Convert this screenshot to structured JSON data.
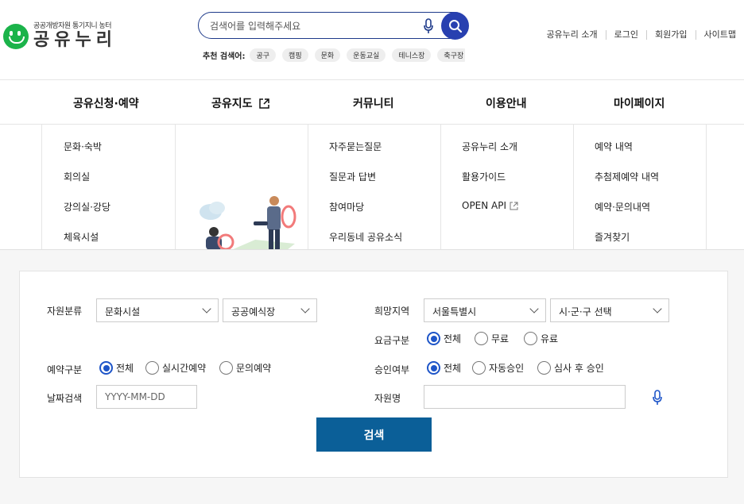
{
  "header": {
    "logo_sub": "공공개방자원 통기지니 농터",
    "logo_main": "공유누리",
    "search_placeholder": "검색어를 입력해주세요",
    "recommend_label": "추천 검색어:",
    "recommend_tags": [
      "공구",
      "캠핑",
      "문화",
      "운동교실",
      "테니스장",
      "축구장"
    ],
    "util_links": [
      "공유누리 소개",
      "로그인",
      "회원가입",
      "사이트맵"
    ]
  },
  "gnb": {
    "items": [
      "공유신청·예약",
      "공유지도",
      "커뮤니티",
      "이용안내",
      "마이페이지"
    ]
  },
  "submenu": {
    "col1": [
      "문화·숙박",
      "회의실",
      "강의실·강당",
      "체육시설"
    ],
    "col3": [
      "자주묻는질문",
      "질문과 답변",
      "참여마당",
      "우리동네 공유소식"
    ],
    "col4": [
      "공유누리 소개",
      "활용가이드",
      "OPEN API"
    ],
    "col5": [
      "예약 내역",
      "추첨제예약 내역",
      "예약·문의내역",
      "즐겨찾기"
    ]
  },
  "form": {
    "resource_type_label": "자원분류",
    "resource_type_value": "문화시설",
    "resource_subtype_value": "공공예식장",
    "reservation_type_label": "예약구분",
    "reservation_options": [
      "전체",
      "실시간예약",
      "문의예약"
    ],
    "date_label": "날짜검색",
    "date_placeholder": "YYYY-MM-DD",
    "region_label": "희망지역",
    "region_value": "서울특별시",
    "district_value": "시·군·구 선택",
    "fee_label": "요금구분",
    "fee_options": [
      "전체",
      "무료",
      "유료"
    ],
    "approval_label": "승인여부",
    "approval_options": [
      "전체",
      "자동승인",
      "심사 후 승인"
    ],
    "resource_name_label": "자원명",
    "submit_label": "검색"
  },
  "colors": {
    "primary": "#2840b0",
    "submit": "#0b5f98",
    "radio": "#1e55c8",
    "logo": "#1bb34a"
  }
}
